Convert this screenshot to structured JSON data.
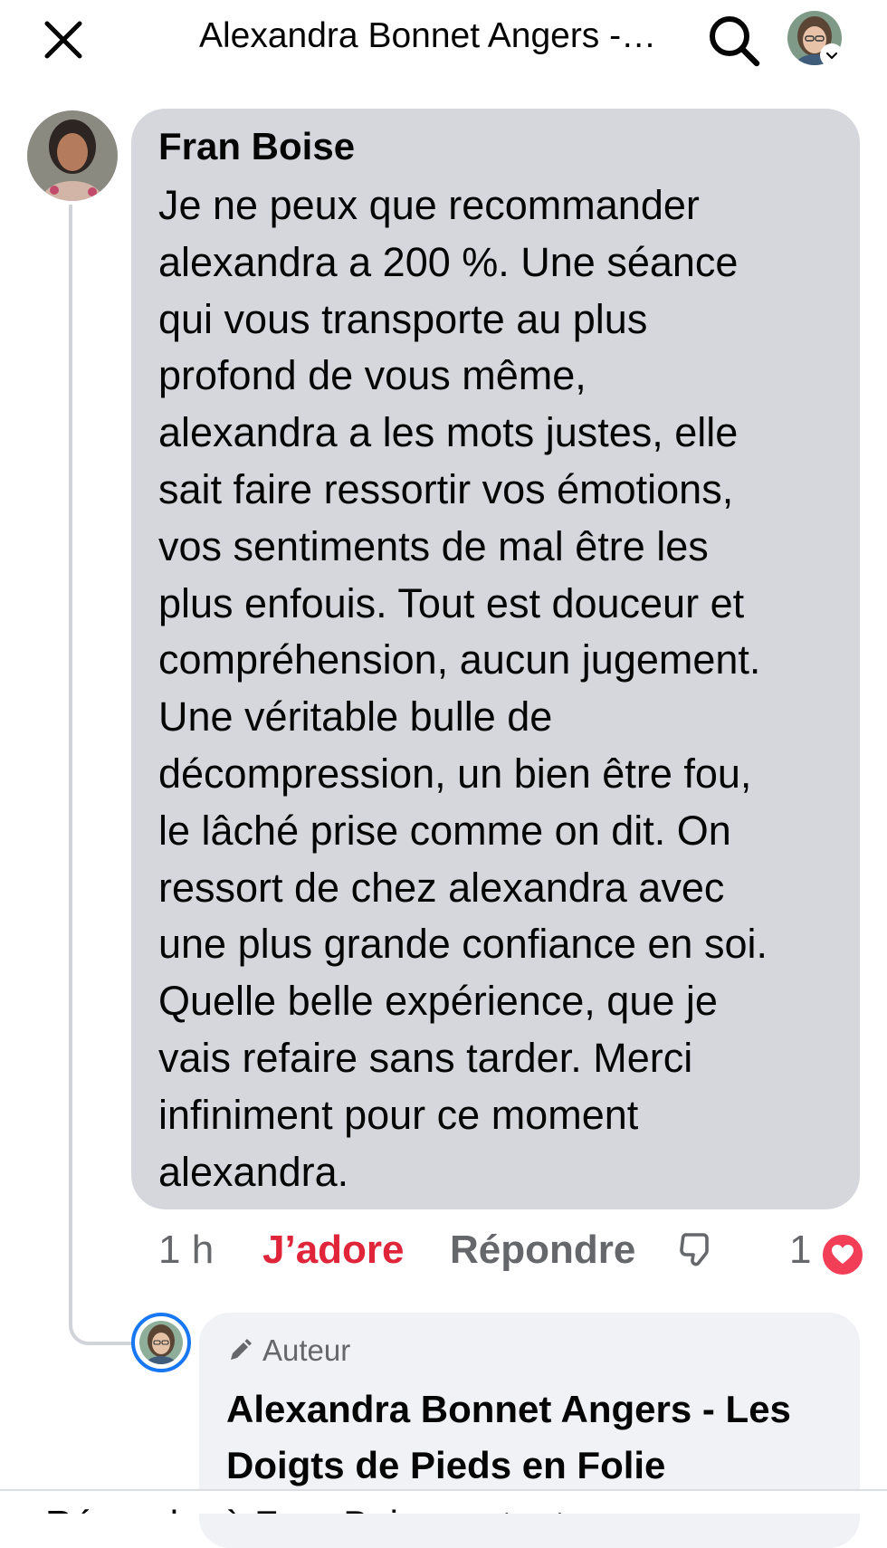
{
  "header": {
    "title": "Alexandra Bonnet Angers -…",
    "close_icon": "close-icon",
    "search_icon": "search-icon"
  },
  "comment": {
    "author": "Fran Boise",
    "text": "Je ne peux que recommander\nalexandra a 200 %. Une séance\nqui vous transporte au plus\nprofond de vous même,\nalexandra a les mots justes, elle\nsait faire ressortir vos émotions,\nvos sentiments de mal être les\nplus enfouis. Tout est douceur et\ncompréhension, aucun jugement.\nUne véritable bulle de\ndécompression, un bien être fou,\nle lâché prise comme on dit.  On\nressort de chez alexandra avec\nune plus grande confiance en soi.\nQuelle belle expérience, que je\nvais refaire sans tarder. Merci\ninfiniment pour ce moment\nalexandra.",
    "time": "1 h",
    "reaction_label": "J’adore",
    "reply_label": "Répondre",
    "reaction_count": "1",
    "reaction_icon": "heart-icon",
    "dislike_icon": "thumbs-down-icon"
  },
  "reply": {
    "badge": "Auteur",
    "badge_icon": "pencil-icon",
    "author": "Alexandra Bonnet Angers - Les Doigts de Pieds en Folie"
  },
  "composer": {
    "placeholder": "Répondre à Fran Boise en tant que"
  },
  "colors": {
    "bubble": "#d5d7dc",
    "reply_bubble": "#f0f2f5",
    "reaction_red": "#e0243a",
    "secondary_text": "#65676b",
    "ring_blue": "#1877f2"
  }
}
